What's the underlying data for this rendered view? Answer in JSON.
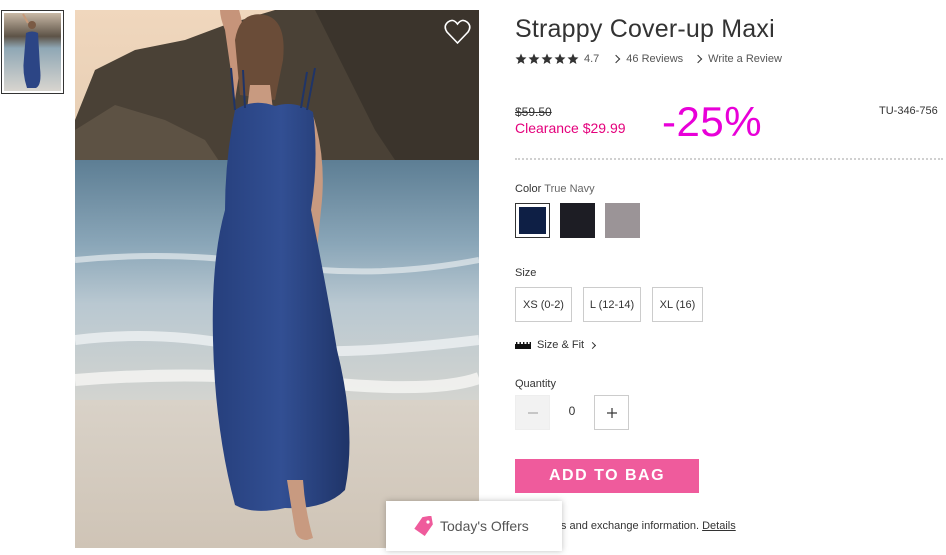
{
  "product": {
    "title": "Strappy Cover-up Maxi",
    "rating": "4.7",
    "stars": 5,
    "reviews_link": "46 Reviews",
    "write_review_link": "Write a Review",
    "original_price": "$59.50",
    "sale_price": "Clearance $29.99",
    "discount_badge": "-25%",
    "sku": "TU-346-756"
  },
  "color": {
    "label": "Color",
    "selected": "True Navy",
    "swatches": [
      {
        "name": "True Navy",
        "hex": "#0e1f45"
      },
      {
        "name": "Black",
        "hex": "#1d1d24"
      },
      {
        "name": "Grey",
        "hex": "#9b9497"
      }
    ]
  },
  "size": {
    "label": "Size",
    "options": [
      "XS (0-2)",
      "L (12-14)",
      "XL (16)"
    ],
    "fit_link": "Size & Fit"
  },
  "quantity": {
    "label": "Quantity",
    "value": "0",
    "minus": "−",
    "plus": "+"
  },
  "cta": {
    "add_to_bag": "ADD TO BAG"
  },
  "returns": {
    "text": "urns and exchange information.",
    "link": "Details"
  },
  "offers": {
    "label": "Today's Offers"
  },
  "colors": {
    "accent_pink": "#ef5b9c",
    "clearance_pink": "#e4007c",
    "discount_magenta": "#e800d8"
  }
}
